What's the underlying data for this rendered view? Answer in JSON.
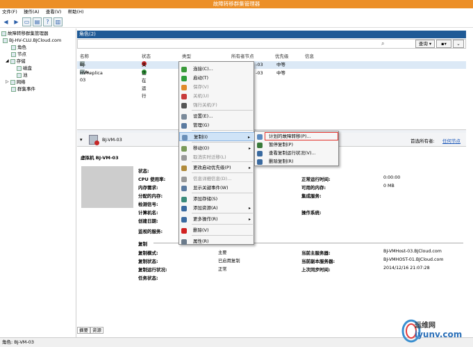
{
  "window": {
    "title": "故障转移群集管理器"
  },
  "menu": [
    "文件(F)",
    "操作(A)",
    "查看(V)",
    "帮助(H)"
  ],
  "sidebar": {
    "items": [
      {
        "label": "故障转移群集管理器",
        "level": 0
      },
      {
        "label": "BJ-HV-CLU.BJCloud.com",
        "level": 1
      },
      {
        "label": "角色",
        "level": 2
      },
      {
        "label": "节点",
        "level": 2
      },
      {
        "label": "存储",
        "level": 2
      },
      {
        "label": "磁盘",
        "level": 3
      },
      {
        "label": "池",
        "level": 3
      },
      {
        "label": "网络",
        "level": 2
      },
      {
        "label": "群集事件",
        "level": 2
      }
    ]
  },
  "roles": {
    "header": "角色(2)",
    "query_label": "查询",
    "columns": [
      "名称",
      "状态",
      "类型",
      "所有者节点",
      "优先级",
      "信息"
    ],
    "rows": [
      {
        "name": "BJ-VM-03",
        "status": "关机",
        "type": "",
        "owner": "-03",
        "priority": "中等"
      },
      {
        "name": "HVReplica",
        "status": "正在运行",
        "type": "",
        "owner": "-03",
        "priority": "中等"
      }
    ]
  },
  "context_menu": {
    "items": [
      {
        "label": "连接(C)...",
        "icon": "connect-icon",
        "color": "#3a9a3a",
        "disabled": false,
        "arrow": false
      },
      {
        "label": "启动(T)",
        "icon": "start-icon",
        "color": "#2e9d3a",
        "disabled": false,
        "arrow": false
      },
      {
        "label": "保存(V)",
        "icon": "save-icon",
        "color": "#e08a2a",
        "disabled": true,
        "arrow": false
      },
      {
        "label": "关机(U)",
        "icon": "shutdown-icon",
        "color": "#c83a3a",
        "disabled": true,
        "arrow": false
      },
      {
        "label": "强行关机(F)",
        "icon": "turn-off-icon",
        "color": "#555555",
        "disabled": true,
        "arrow": false
      },
      {
        "label": "设置(E)...",
        "icon": "settings-icon",
        "color": "#7a8a9a",
        "disabled": false,
        "arrow": false
      },
      {
        "label": "管理(G)",
        "icon": "manage-icon",
        "color": "#5a7aa0",
        "disabled": false,
        "arrow": false
      },
      {
        "label": "复制(I)",
        "icon": "replication-icon",
        "color": "#6a8fb8",
        "disabled": false,
        "arrow": true
      },
      {
        "label": "移动(O)",
        "icon": "move-icon",
        "color": "#7a9a5a",
        "disabled": false,
        "arrow": true
      },
      {
        "label": "取消实时迁移(L)",
        "icon": "cancel-migration-icon",
        "color": "#999999",
        "disabled": true,
        "arrow": false
      },
      {
        "label": "更改启动优先级(P)",
        "icon": "priority-icon",
        "color": "#b08a3a",
        "disabled": false,
        "arrow": true
      },
      {
        "label": "信息详细信息(D)...",
        "icon": "info-details-icon",
        "color": "#999999",
        "disabled": true,
        "arrow": false
      },
      {
        "label": "显示关键事件(W)",
        "icon": "events-icon",
        "color": "#5a7aa0",
        "disabled": false,
        "arrow": false
      },
      {
        "label": "添加存储(S)",
        "icon": "add-storage-icon",
        "color": "#3a8a7a",
        "disabled": false,
        "arrow": false
      },
      {
        "label": "添加资源(A)",
        "icon": "add-resource-icon",
        "color": "#3a6aa0",
        "disabled": false,
        "arrow": true
      },
      {
        "label": "更多操作(R)",
        "icon": "more-actions-icon",
        "color": "#3a6aa0",
        "disabled": false,
        "arrow": true
      },
      {
        "label": "删除(V)",
        "icon": "delete-icon",
        "color": "#d02020",
        "disabled": false,
        "arrow": false
      },
      {
        "label": "属性(R)",
        "icon": "properties-icon",
        "color": "#6a7a8a",
        "disabled": false,
        "arrow": false
      }
    ]
  },
  "submenu": {
    "items": [
      {
        "label": "计划的故障转移(P)...",
        "icon": "planned-failover-icon",
        "color": "#5a8ac0"
      },
      {
        "label": "暂停复制(P)",
        "icon": "pause-replication-icon",
        "color": "#3a7a3a"
      },
      {
        "label": "查看复制运行状况(V)...",
        "icon": "replication-health-icon",
        "color": "#3a6aa0"
      },
      {
        "label": "删除复制(R)",
        "icon": "remove-replication-icon",
        "color": "#3a6aa0"
      }
    ]
  },
  "detail": {
    "vm_name": "BJ-VM-03",
    "owner_label": "首选所有者:",
    "owner_link": "任何节点",
    "title": "虚拟机 BJ-VM-03",
    "left_labels": [
      "状态:",
      "CPU 使用率:",
      "内存需求:",
      "分配的内存:",
      "检测信号:",
      "计算机名:",
      "创建日期:",
      "监视的服务:"
    ],
    "right_labels": [
      "正常运行时间:",
      "可用的内存:",
      "集成服务:",
      "操作系统:"
    ],
    "right_values": [
      "0:00:00",
      "0 MB",
      "",
      ""
    ],
    "repl_section": "复制",
    "repl_labels": [
      "复制模式:",
      "复制状态:",
      "复制运行状况:",
      "任务状态:"
    ],
    "repl_values": [
      "主要",
      "已启用复制",
      "正常",
      ""
    ],
    "repl_right_labels": [
      "当前主服务器:",
      "当前副本服务器:",
      "上次同步时间:"
    ],
    "repl_right_values": [
      "BJ-VMHost-03.BJCloud.com",
      "BJ-VMHOST-01.BJCloud.com",
      "2014/12/16 21:07:28"
    ],
    "tabs": [
      "摘要",
      "资源"
    ]
  },
  "status": {
    "text": "角色: BJ-VM-03"
  },
  "watermark": {
    "top": "运维网",
    "bottom": "iyunv.com"
  }
}
